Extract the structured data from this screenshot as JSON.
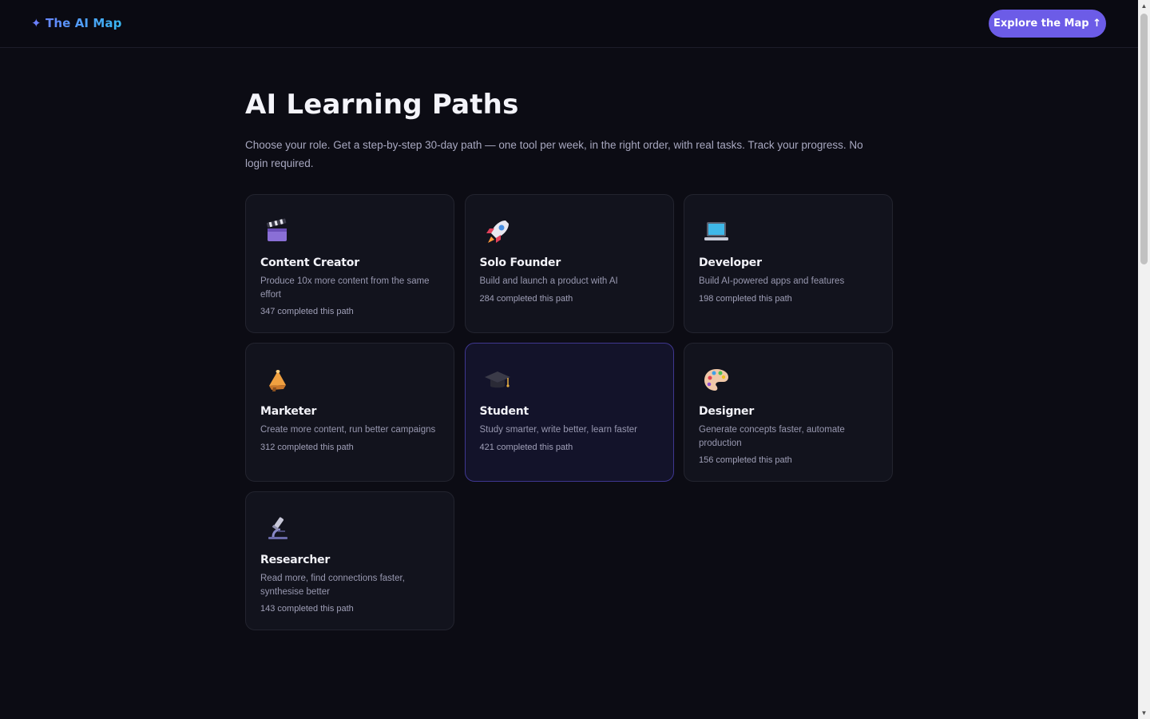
{
  "header": {
    "logo": "✦ The AI Map",
    "cta_label": "Explore the Map ↑"
  },
  "hero": {
    "title": "AI Learning Paths",
    "subtitle": "Choose your role. Get a step-by-step 30-day path — one tool per week, in the right order, with real tasks. Track your progress. No login required."
  },
  "paths": [
    {
      "icon": "clapperboard-icon",
      "name": "Content Creator",
      "description": "Produce 10x more content from the same effort",
      "completed": "347 completed this path"
    },
    {
      "icon": "rocket-icon",
      "name": "Solo Founder",
      "description": "Build and launch a product with AI",
      "completed": "284 completed this path"
    },
    {
      "icon": "laptop-icon",
      "name": "Developer",
      "description": "Build AI-powered apps and features",
      "completed": "198 completed this path"
    },
    {
      "icon": "megaphone-icon",
      "name": "Marketer",
      "description": "Create more content, run better campaigns",
      "completed": "312 completed this path"
    },
    {
      "icon": "graduation-cap-icon",
      "name": "Student",
      "description": "Study smarter, write better, learn faster",
      "completed": "421 completed this path"
    },
    {
      "icon": "palette-icon",
      "name": "Designer",
      "description": "Generate concepts faster, automate production",
      "completed": "156 completed this path"
    },
    {
      "icon": "microscope-icon",
      "name": "Researcher",
      "description": "Read more, find connections faster, synthesise better",
      "completed": "143 completed this path"
    }
  ],
  "colors": {
    "background": "#0c0c14",
    "card": "#12131d",
    "accent": "#6c5ce7",
    "active_border": "#3f3790"
  }
}
